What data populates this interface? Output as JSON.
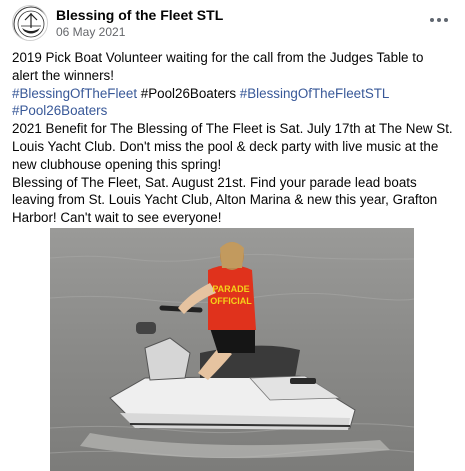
{
  "header": {
    "page_name": "Blessing of the Fleet STL",
    "date": "06 May 2021",
    "more_icon": "more-horizontal-icon",
    "avatar_text": "FLEET"
  },
  "body": {
    "line1": "2019 Pick Boat Volunteer waiting for the call from the Judges Table to",
    "line2": "alert the winners!",
    "hashtags_line": [
      {
        "text": "#BlessingOfTheFleet",
        "link": true
      },
      {
        "text": " #Pool26Boaters ",
        "link": false
      },
      {
        "text": "#BlessingOfTheFleetSTL",
        "link": true
      }
    ],
    "hashtag_pool": "#Pool26Boaters",
    "line5": "2021 Benefit for The Blessing of The Fleet is Sat. July 17th at The New St.",
    "line6": "Louis Yacht Club.  Don't miss the pool & deck party with live music at the",
    "line7": "new clubhouse opening this spring!",
    "line8": "Blessing of The Fleet, Sat. August 21st.  Find your parade lead boats",
    "line9": "leaving from St. Louis Yacht Club, Alton Marina & new this year, Grafton",
    "line10": "Harbor! Can't wait to see everyone!"
  },
  "photo": {
    "shirt_text_1": "PARADE",
    "shirt_text_2": "OFFICIAL",
    "colors": {
      "water": "#8f8f8f",
      "shirt": "#e0321c",
      "jetski": "#ececec"
    }
  },
  "colors": {
    "link": "#385898",
    "secondary": "#65676b"
  }
}
